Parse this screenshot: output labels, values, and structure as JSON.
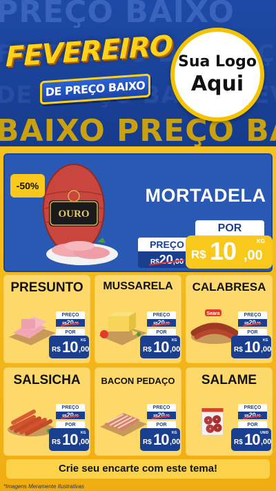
{
  "header": {
    "bg_top": "PREÇO BAIXO",
    "bg_mid1": "FEVEREIRO DE PREÇO BAIXO FEVEREIRO",
    "bg_mid2": "DE PREÇO BAIXO FEVEREIRO DE PREÇO",
    "bg_bottom": "BAIXO PREÇO BAIXO",
    "title_main": "FEVEREIRO",
    "title_sub": "DE PREÇO BAIXO",
    "logo_line1": "Sua Logo",
    "logo_line2": "Aqui"
  },
  "featured": {
    "discount": "-50%",
    "name": "MORTADELA",
    "brand": "OURO",
    "preco_label": "PREÇO",
    "old_currency": "R$",
    "old_int": "20",
    "old_cents": ",00",
    "por_label": "POR",
    "currency": "R$",
    "price_int": "10",
    "price_cents": ",00",
    "unit": "KG"
  },
  "products": [
    {
      "name": "PRESUNTO",
      "preco_label": "PREÇO",
      "old_currency": "R$",
      "old_int": "20",
      "old_cents": ",00",
      "por_label": "POR",
      "currency": "R$",
      "price_int": "10",
      "price_cents": ",00",
      "unit": "KG"
    },
    {
      "name": "MUSSARELA",
      "preco_label": "PREÇO",
      "old_currency": "R$",
      "old_int": "20",
      "old_cents": ",00",
      "por_label": "POR",
      "currency": "R$",
      "price_int": "10",
      "price_cents": ",00",
      "unit": "KG"
    },
    {
      "name": "CALABRESA",
      "preco_label": "PREÇO",
      "old_currency": "R$",
      "old_int": "20",
      "old_cents": ",00",
      "por_label": "POR",
      "currency": "R$",
      "price_int": "10",
      "price_cents": ",00",
      "unit": "KG",
      "brand": "Seara"
    },
    {
      "name": "SALSICHA",
      "preco_label": "PREÇO",
      "old_currency": "R$",
      "old_int": "20",
      "old_cents": ",00",
      "por_label": "POR",
      "currency": "R$",
      "price_int": "10",
      "price_cents": ",00",
      "unit": "KG"
    },
    {
      "name": "BACON PEDAÇO",
      "preco_label": "PREÇO",
      "old_currency": "R$",
      "old_int": "20",
      "old_cents": ",00",
      "por_label": "POR",
      "currency": "R$",
      "price_int": "10",
      "price_cents": ",00",
      "unit": "KG"
    },
    {
      "name": "SALAME",
      "preco_label": "PREÇO",
      "old_currency": "R$",
      "old_int": "20",
      "old_cents": ",00",
      "por_label": "POR",
      "currency": "R$",
      "price_int": "10",
      "price_cents": ",00",
      "unit": "UNID"
    }
  ],
  "footer": {
    "cta": "Crie seu encarte com este tema!",
    "disclaimer": "*Imagens Meramente Ilustrativas"
  },
  "colors": {
    "blue": "#1b3f8f",
    "yellow": "#f8c81d",
    "card": "#fdd86b",
    "strike": "#e53030"
  }
}
